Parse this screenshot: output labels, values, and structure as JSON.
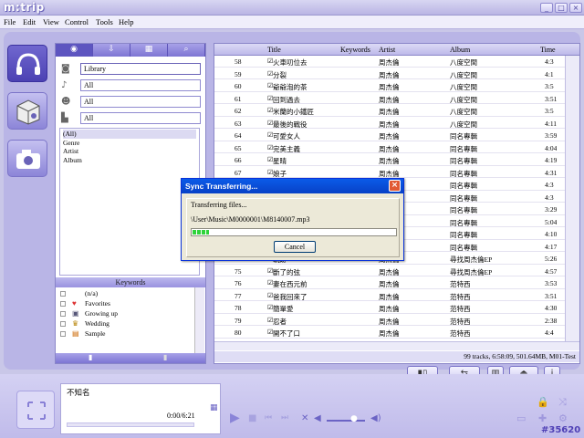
{
  "app": {
    "title": "m:trip",
    "window_buttons": [
      "_",
      "□",
      "×"
    ]
  },
  "menu": [
    "File",
    "Edit",
    "View",
    "Control",
    "Tools",
    "Help"
  ],
  "filters": {
    "source": "Library",
    "genre": "All",
    "artist": "All",
    "album": "All"
  },
  "categories": [
    "(All)",
    "Genre",
    "Artist",
    "Album"
  ],
  "keywords": {
    "header": "Keywords",
    "items": [
      {
        "label": "(n/a)",
        "icon": "none"
      },
      {
        "label": "Favorites",
        "icon": "heart-icon"
      },
      {
        "label": "Growing up",
        "icon": "photo-icon"
      },
      {
        "label": "Wedding",
        "icon": "trophy-icon"
      },
      {
        "label": "Sample",
        "icon": "picture-icon"
      }
    ]
  },
  "table": {
    "columns": [
      "Title",
      "Keywords",
      "Artist",
      "Album",
      "Time"
    ],
    "rows": [
      {
        "num": "58",
        "title": "火車叨位去",
        "artist": "周杰倫",
        "album": "八度空間",
        "time": "4:3"
      },
      {
        "num": "59",
        "title": "分裂",
        "artist": "周杰倫",
        "album": "八度空間",
        "time": "4:1"
      },
      {
        "num": "60",
        "title": "爺爺泡的茶",
        "artist": "周杰倫",
        "album": "八度空間",
        "time": "3:5"
      },
      {
        "num": "61",
        "title": "回到過去",
        "artist": "周杰倫",
        "album": "八度空間",
        "time": "3:51"
      },
      {
        "num": "62",
        "title": "米蘭的小鐵匠",
        "artist": "周杰倫",
        "album": "八度空間",
        "time": "3:5"
      },
      {
        "num": "63",
        "title": "最後的戰役",
        "artist": "周杰倫",
        "album": "八度空間",
        "time": "4:11"
      },
      {
        "num": "64",
        "title": "可愛女人",
        "artist": "周杰倫",
        "album": "同名專輯",
        "time": "3:59"
      },
      {
        "num": "65",
        "title": "完美主義",
        "artist": "周杰倫",
        "album": "同名專輯",
        "time": "4:04"
      },
      {
        "num": "66",
        "title": "星晴",
        "artist": "周杰倫",
        "album": "同名專輯",
        "time": "4:19"
      },
      {
        "num": "67",
        "title": "娘子",
        "artist": "周杰倫",
        "album": "同名專輯",
        "time": "4:31"
      },
      {
        "num": "68",
        "title": "",
        "artist": "周杰倫",
        "album": "同名專輯",
        "time": "4:3"
      },
      {
        "num": "69",
        "title": "",
        "artist": "周杰倫",
        "album": "同名專輯",
        "time": "4:3"
      },
      {
        "num": "70",
        "title": "",
        "artist": "周杰倫",
        "album": "同名專輯",
        "time": "3:29"
      },
      {
        "num": "71",
        "title": "",
        "artist": "周杰倫",
        "album": "同名專輯",
        "time": "5:04"
      },
      {
        "num": "72",
        "title": "",
        "artist": "周杰倫",
        "album": "同名專輯",
        "time": "4:10"
      },
      {
        "num": "73",
        "title": "",
        "artist": "周杰倫",
        "album": "同名專輯",
        "time": "4:17"
      },
      {
        "num": "74",
        "title": "軌跡",
        "artist": "周杰倫",
        "album": "尋找周杰倫EP",
        "time": "5:26"
      },
      {
        "num": "75",
        "title": "斷了的弦",
        "artist": "周杰倫",
        "album": "尋找周杰倫EP",
        "time": "4:57"
      },
      {
        "num": "76",
        "title": "妻在西元前",
        "artist": "周杰倫",
        "album": "范特西",
        "time": "3:53"
      },
      {
        "num": "77",
        "title": "爸我回來了",
        "artist": "周杰倫",
        "album": "范特西",
        "time": "3:51"
      },
      {
        "num": "78",
        "title": "簡單愛",
        "artist": "周杰倫",
        "album": "范特西",
        "time": "4:30"
      },
      {
        "num": "79",
        "title": "忍者",
        "artist": "周杰倫",
        "album": "范特西",
        "time": "2:38"
      },
      {
        "num": "80",
        "title": "開不了口",
        "artist": "周杰倫",
        "album": "范特西",
        "time": "4:4"
      }
    ],
    "status": "99 tracks, 6:58:09, 501.64MB, M01-Test"
  },
  "dialog": {
    "title": "Sync Transferring...",
    "label": "Transferring files...",
    "path": "\\User\\Music\\M0000001\\M8140007.mp3",
    "progress": 0.08,
    "cancel": "Cancel",
    "close": "×"
  },
  "player": {
    "track": "不知名",
    "time": "0:00/6:21"
  },
  "tag": "#35620",
  "colors": {
    "accent": "#7067cf",
    "frame": "#b9b5e6",
    "dialog_title": "#0a5be8",
    "progress": "#2fd33a"
  }
}
